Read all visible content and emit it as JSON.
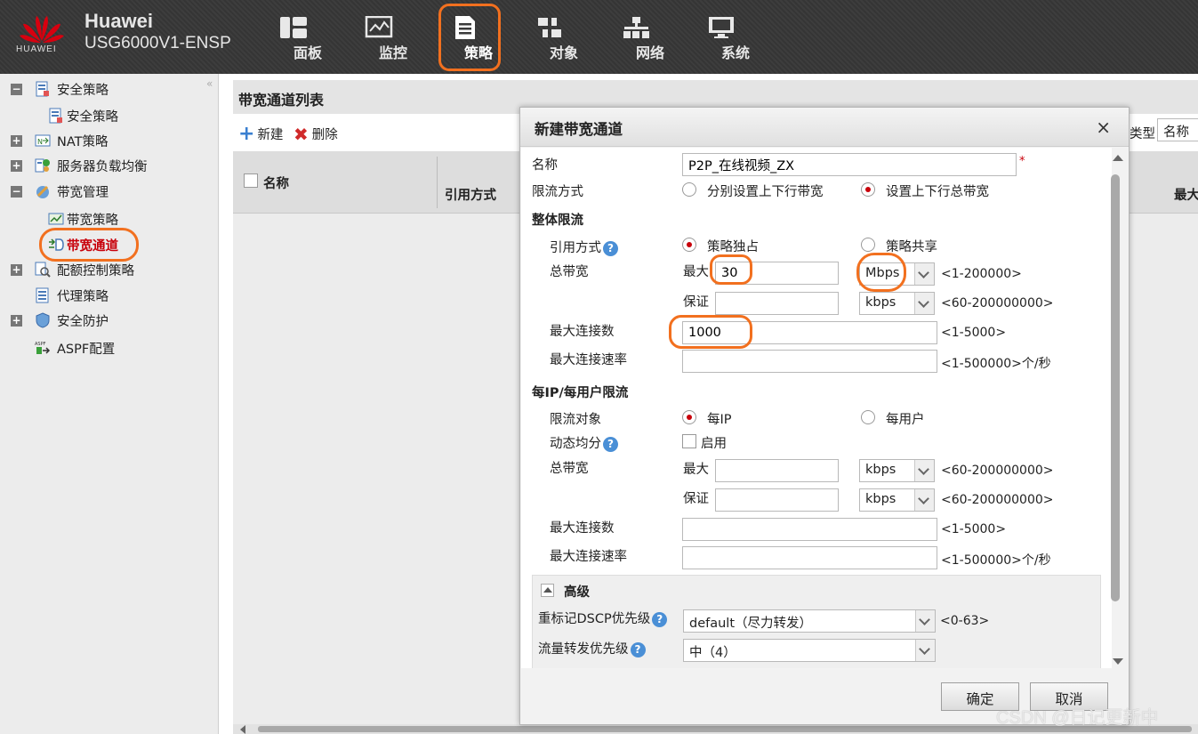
{
  "header": {
    "brand_name": "Huawei",
    "device_model": "USG6000V1-ENSP",
    "logo_text": "HUAWEI",
    "nav": [
      {
        "label": "面板",
        "icon": "dashboard-icon"
      },
      {
        "label": "监控",
        "icon": "monitor-icon"
      },
      {
        "label": "策略",
        "icon": "policy-document-icon"
      },
      {
        "label": "对象",
        "icon": "object-icon"
      },
      {
        "label": "网络",
        "icon": "network-icon"
      },
      {
        "label": "系统",
        "icon": "system-icon"
      }
    ],
    "active_nav": "策略"
  },
  "sidebar": {
    "items": [
      {
        "label": "安全策略",
        "expander": "−"
      },
      {
        "label": "安全策略"
      },
      {
        "label": "NAT策略",
        "expander": "+"
      },
      {
        "label": "服务器负载均衡",
        "expander": "+"
      },
      {
        "label": "带宽管理",
        "expander": "−"
      },
      {
        "label": "带宽策略"
      },
      {
        "label": "带宽通道"
      },
      {
        "label": "配额控制策略",
        "expander": "+"
      },
      {
        "label": "代理策略"
      },
      {
        "label": "安全防护",
        "expander": "+"
      },
      {
        "label": "ASPF配置"
      }
    ],
    "active_item": "带宽通道"
  },
  "main": {
    "title": "带宽通道列表",
    "toolbar": {
      "new_label": "新建",
      "delete_label": "删除"
    },
    "grid": {
      "col_name": "名称",
      "col_ref": "引用方式",
      "col_max": "最大"
    },
    "filter": {
      "type_label": "类型",
      "type_value": "名称"
    }
  },
  "dialog": {
    "title": "新建带宽通道",
    "close": "×",
    "name_label": "名称",
    "name_value": "P2P_在线视频_ZX",
    "required_mark": "*",
    "limit_mode_label": "限流方式",
    "limit_mode_options": [
      "分别设置上下行带宽",
      "设置上下行总带宽"
    ],
    "limit_mode_selected": 1,
    "overall": {
      "section": "整体限流",
      "ref_mode_label": "引用方式",
      "ref_mode_options": [
        "策略独占",
        "策略共享"
      ],
      "ref_mode_selected": 0,
      "total_bw_label": "总带宽",
      "max_label": "最大",
      "max_value": "30",
      "max_unit": "Mbps",
      "max_range": "<1-200000>",
      "guar_label": "保证",
      "guar_value": "",
      "guar_unit": "kbps",
      "guar_range": "<60-200000000>",
      "max_conn_label": "最大连接数",
      "max_conn_value": "1000",
      "max_conn_range": "<1-5000>",
      "max_rate_label": "最大连接速率",
      "max_rate_value": "",
      "max_rate_range": "<1-500000>个/秒"
    },
    "per_ip": {
      "section": "每IP/每用户限流",
      "target_label": "限流对象",
      "target_options": [
        "每IP",
        "每用户"
      ],
      "target_selected": 0,
      "dynamic_label": "动态均分",
      "enable_label": "启用",
      "enabled": false,
      "total_bw_label": "总带宽",
      "max_label": "最大",
      "max_value": "",
      "max_unit": "kbps",
      "max_range": "<60-200000000>",
      "guar_label": "保证",
      "guar_value": "",
      "guar_unit": "kbps",
      "guar_range": "<60-200000000>",
      "max_conn_label": "最大连接数",
      "max_conn_value": "",
      "max_conn_range": "<1-5000>",
      "max_rate_label": "最大连接速率",
      "max_rate_value": "",
      "max_rate_range": "<1-500000>个/秒"
    },
    "advanced": {
      "section": "高级",
      "dscp_label": "重标记DSCP优先级",
      "dscp_value": "default（尽力转发）",
      "dscp_range": "<0-63>",
      "fwd_label": "流量转发优先级",
      "fwd_value": "中（4）"
    },
    "ok_label": "确定",
    "cancel_label": "取消"
  },
  "watermark": "CSDN @日记更新中",
  "colors": {
    "accent_red": "#c8000a",
    "annotation": "#f2701f",
    "header_bg": "#3a3a3a"
  }
}
